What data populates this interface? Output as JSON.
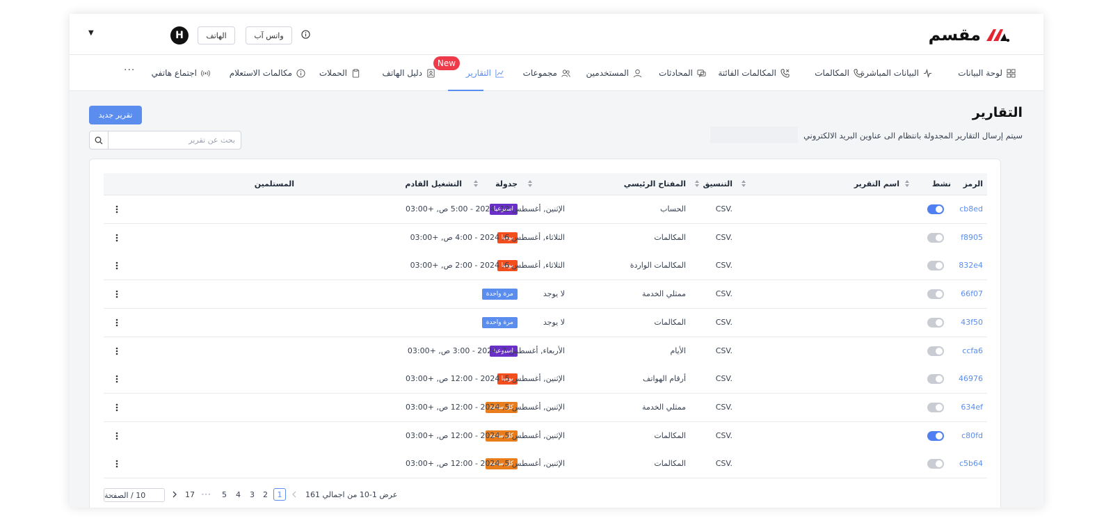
{
  "topbar": {
    "logo_text": "مقسم",
    "brand_color": "#e3262f",
    "avatar_letter": "H",
    "phone_button": "الهاتف",
    "whatsapp_button": "واتس آب"
  },
  "nav": {
    "items": [
      {
        "label": "لوحة البيانات",
        "icon": "grid-icon"
      },
      {
        "label": "البيانات المباشرة",
        "icon": "pulse-icon"
      },
      {
        "label": "المكالمات",
        "icon": "phone-icon"
      },
      {
        "label": "المكالمات الفائتة",
        "icon": "missed-call-icon"
      },
      {
        "label": "المحادثات",
        "icon": "chat-icon"
      },
      {
        "label": "المستخدمين",
        "icon": "user-icon"
      },
      {
        "label": "مجموعات",
        "icon": "users-icon"
      },
      {
        "label": "التقارير",
        "icon": "chart-icon",
        "active": true
      },
      {
        "label": "دليل الهاتف",
        "icon": "contact-book-icon"
      },
      {
        "label": "الحملات",
        "icon": "clipboard-icon"
      },
      {
        "label": "مكالمات الاستعلام",
        "icon": "info-icon"
      },
      {
        "label": "اجتماع هاتفي",
        "icon": "broadcast-icon"
      }
    ],
    "new_badge": "New",
    "more": "···",
    "active_color": "#5b8def"
  },
  "page": {
    "title": "التقارير",
    "subtitle": "سيتم إرسال التقارير المجدولة بانتظام الى عناوين البريد الالكتروني",
    "new_report_button": "تقرير جديد",
    "search_placeholder": "بحث عن تقرير"
  },
  "table": {
    "headers": {
      "code": "الرمز",
      "active": "نشط",
      "name": "اسم التقرير",
      "format": "التنسيق",
      "main_key": "المفتاح الرئيسي",
      "schedule": "جدولة",
      "next_run": "التشغيل القادم",
      "recipients": "المستلمين"
    },
    "rows": [
      {
        "code": "cb8ed",
        "active": true,
        "format": "CSV.",
        "key": "الحساب",
        "schedule": "اسبوعيا",
        "schedule_type": "weekly",
        "next": "الإثنين, أغسطس 12, 2024 - 5:00 ص, +03:00"
      },
      {
        "code": "f8905",
        "active": false,
        "format": "CSV.",
        "key": "المكالمات",
        "schedule": "يوميا",
        "schedule_type": "daily",
        "next": "الثلاثاء, أغسطس 6, 2024 - 4:00 ص, +03:00"
      },
      {
        "code": "832e4",
        "active": false,
        "format": "CSV.",
        "key": "المكالمات الواردة",
        "schedule": "يوميا",
        "schedule_type": "daily",
        "next": "الثلاثاء, أغسطس 6, 2024 - 2:00 ص, +03:00"
      },
      {
        "code": "66f07",
        "active": false,
        "format": "CSV.",
        "key": "ممثلي الخدمة",
        "schedule": "مرة واحدة",
        "schedule_type": "once",
        "next": "لا يوجد"
      },
      {
        "code": "43f50",
        "active": false,
        "format": "CSV.",
        "key": "المكالمات",
        "schedule": "مرة واحدة",
        "schedule_type": "once",
        "next": "لا يوجد"
      },
      {
        "code": "ccfa6",
        "active": false,
        "format": "CSV.",
        "key": "الأيام",
        "schedule": "اسبوعيا",
        "schedule_type": "weekly",
        "next": "الأربعاء, أغسطس 7, 2024 - 3:00 ص, +03:00"
      },
      {
        "code": "46976",
        "active": false,
        "format": "CSV.",
        "key": "أرقام الهواتف",
        "schedule": "يوميا",
        "schedule_type": "daily",
        "next": "الإثنين, أغسطس 5, 2024 - 12:00 ص, +03:00"
      },
      {
        "code": "634ef",
        "active": false,
        "format": "CSV.",
        "key": "ممثلي الخدمة",
        "schedule": "كل ساعة",
        "schedule_type": "hourly",
        "next": "الإثنين, أغسطس 5, 2024 - 12:00 ص, +03:00"
      },
      {
        "code": "c80fd",
        "active": true,
        "format": "CSV.",
        "key": "المكالمات",
        "schedule": "كل ساعة",
        "schedule_type": "hourly",
        "next": "الإثنين, أغسطس 5, 2024 - 12:00 ص, +03:00"
      },
      {
        "code": "c5b64",
        "active": false,
        "format": "CSV.",
        "key": "المكالمات",
        "schedule": "كل ساعة",
        "schedule_type": "hourly",
        "next": "الإثنين, أغسطس 5, 2024 - 12:00 ص, +03:00"
      }
    ]
  },
  "pagination": {
    "summary": "عرض 1-10 من اجمالي 161",
    "pages": [
      "1",
      "2",
      "3",
      "4",
      "5",
      "•••",
      "17"
    ],
    "current": "1",
    "page_size": "10 / الصفحة"
  }
}
